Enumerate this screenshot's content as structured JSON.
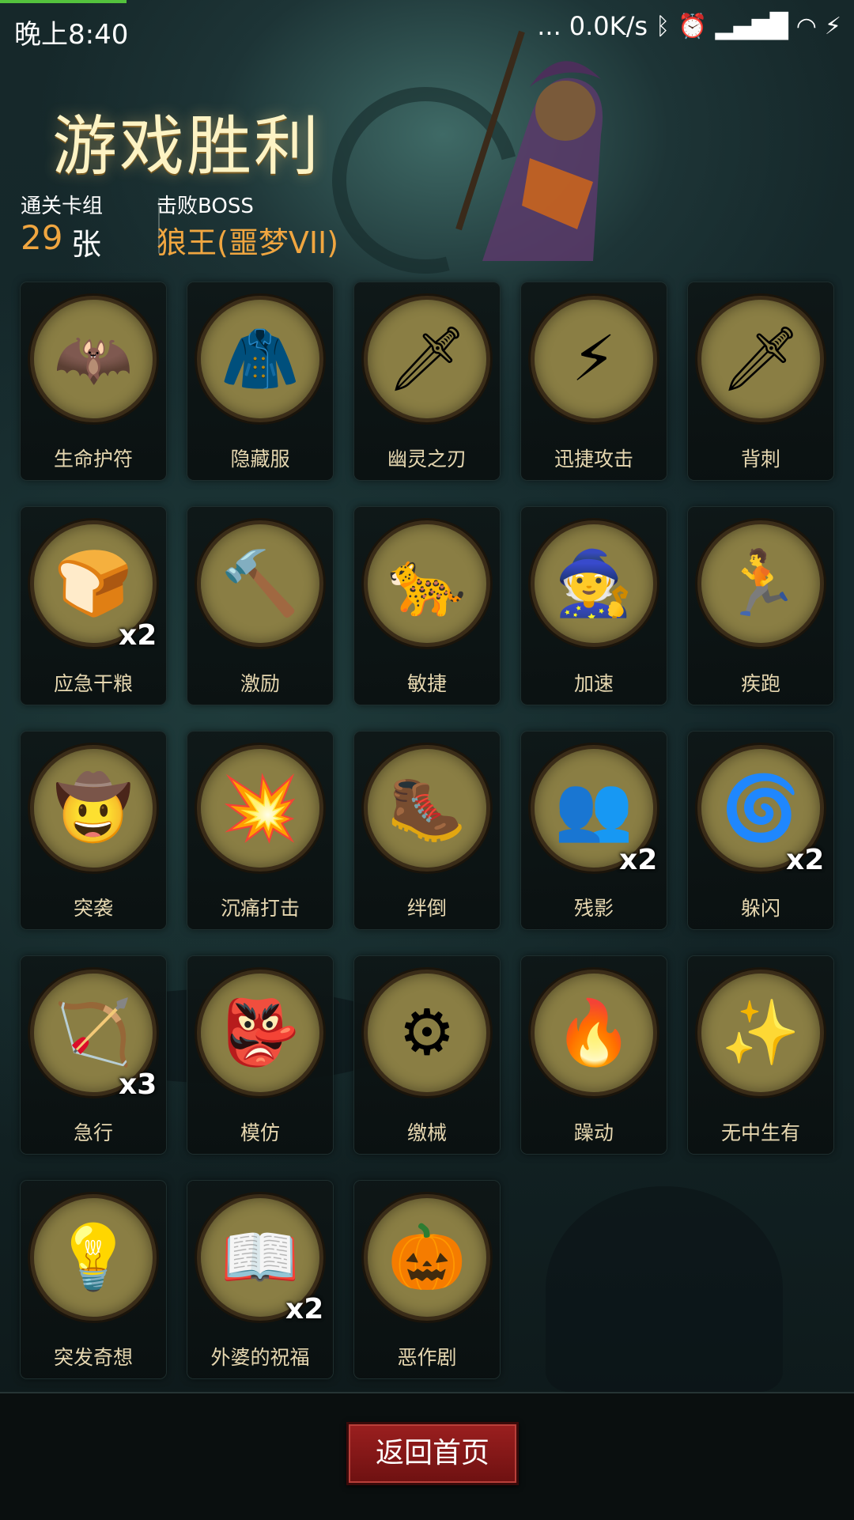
{
  "status_bar": {
    "time": "晚上8:40",
    "net_speed": "0.0K/s",
    "more": "..."
  },
  "header": {
    "title": "游戏胜利",
    "deck_label": "通关卡组",
    "deck_count": "29",
    "deck_unit": "张",
    "boss_label": "击败BOSS",
    "boss_name": "狼王(噩梦VII)"
  },
  "cards": [
    {
      "name": "生命护符",
      "icon": "bat-icon",
      "glyph": "🦇",
      "count": ""
    },
    {
      "name": "隐藏服",
      "icon": "cloak-icon",
      "glyph": "🧥",
      "count": ""
    },
    {
      "name": "幽灵之刃",
      "icon": "blade-icon",
      "glyph": "🗡",
      "count": ""
    },
    {
      "name": "迅捷攻击",
      "icon": "swift-strike-icon",
      "glyph": "⚡",
      "count": ""
    },
    {
      "name": "背刺",
      "icon": "backstab-icon",
      "glyph": "🗡",
      "count": ""
    },
    {
      "name": "应急干粮",
      "icon": "rations-icon",
      "glyph": "🍞",
      "count": "x2"
    },
    {
      "name": "激励",
      "icon": "hammer-icon",
      "glyph": "🔨",
      "count": ""
    },
    {
      "name": "敏捷",
      "icon": "panther-icon",
      "glyph": "🐆",
      "count": ""
    },
    {
      "name": "加速",
      "icon": "witch-icon",
      "glyph": "🧙",
      "count": ""
    },
    {
      "name": "疾跑",
      "icon": "running-creature-icon",
      "glyph": "🏃",
      "count": ""
    },
    {
      "name": "突袭",
      "icon": "raid-icon",
      "glyph": "🤠",
      "count": ""
    },
    {
      "name": "沉痛打击",
      "icon": "heavy-blow-icon",
      "glyph": "💥",
      "count": ""
    },
    {
      "name": "绊倒",
      "icon": "trip-icon",
      "glyph": "🥾",
      "count": ""
    },
    {
      "name": "残影",
      "icon": "afterimage-icon",
      "glyph": "👥",
      "count": "x2"
    },
    {
      "name": "躲闪",
      "icon": "dodge-icon",
      "glyph": "🌀",
      "count": "x2"
    },
    {
      "name": "急行",
      "icon": "rush-icon",
      "glyph": "🏹",
      "count": "x3"
    },
    {
      "name": "模仿",
      "icon": "goblin-icon",
      "glyph": "👺",
      "count": ""
    },
    {
      "name": "缴械",
      "icon": "disarm-icon",
      "glyph": "⚙",
      "count": ""
    },
    {
      "name": "躁动",
      "icon": "frenzy-icon",
      "glyph": "🔥",
      "count": ""
    },
    {
      "name": "无中生有",
      "icon": "something-from-nothing-icon",
      "glyph": "✨",
      "count": ""
    },
    {
      "name": "突发奇想",
      "icon": "idea-icon",
      "glyph": "💡",
      "count": ""
    },
    {
      "name": "外婆的祝福",
      "icon": "grandma-icon",
      "glyph": "📖",
      "count": "x2"
    },
    {
      "name": "恶作剧",
      "icon": "prank-icon",
      "glyph": "🎃",
      "count": ""
    }
  ],
  "footer": {
    "home_button": "返回首页"
  },
  "colors": {
    "accent_orange": "#f0a640",
    "title_cream": "#fdf3c4",
    "button_red": "#8a1a1a"
  }
}
